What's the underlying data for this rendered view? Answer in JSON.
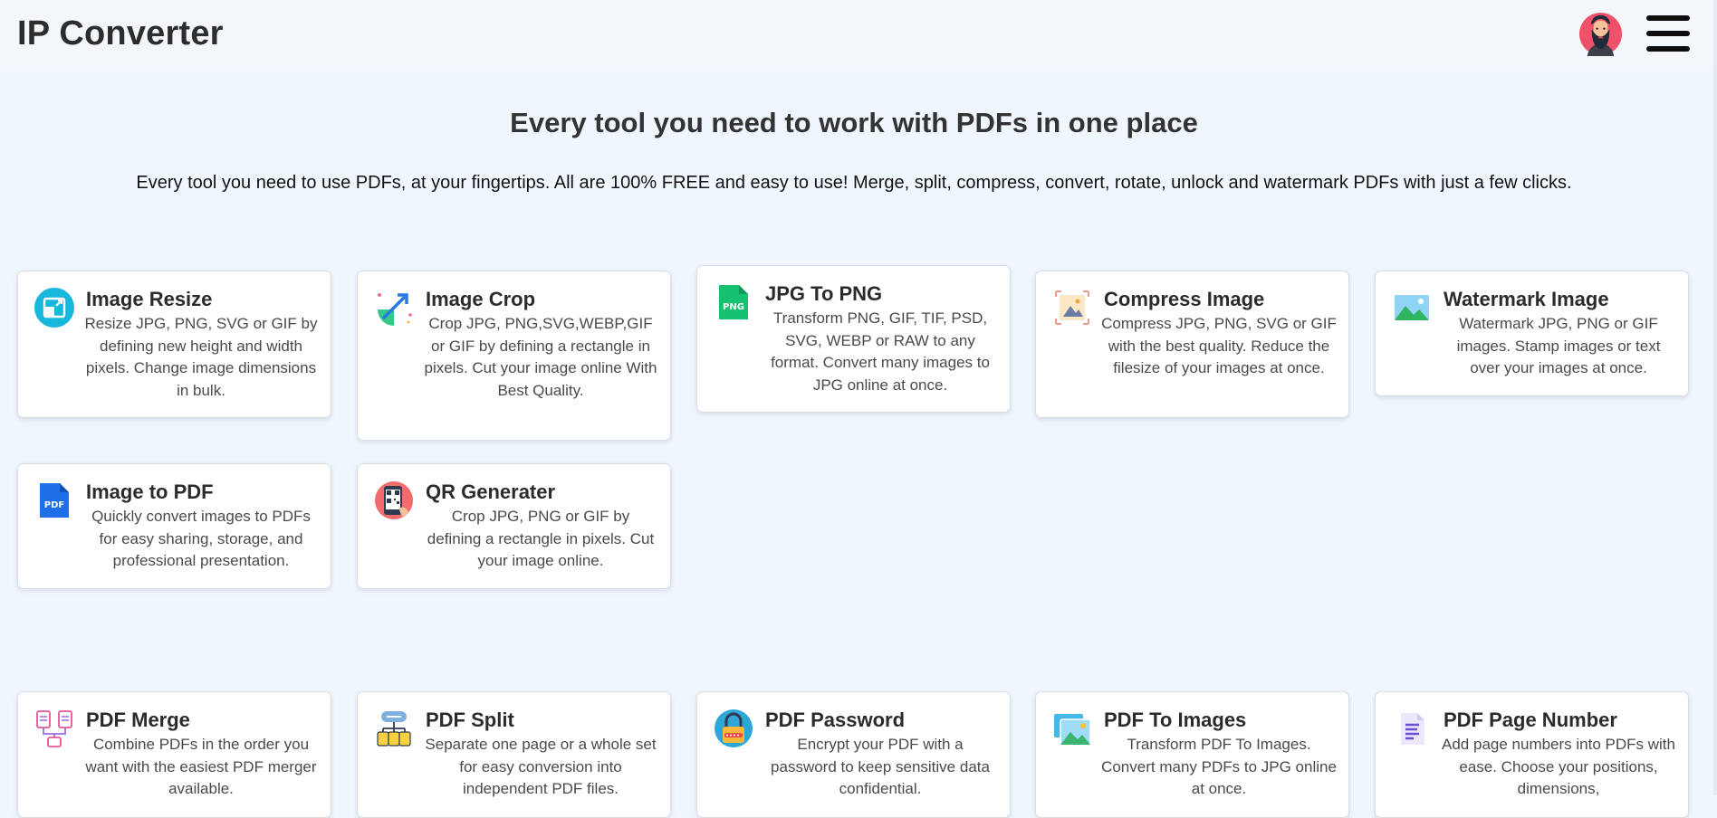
{
  "header": {
    "app_title": "IP Converter"
  },
  "hero": {
    "title": "Every tool you need to work with PDFs in one place",
    "subtitle": "Every tool you need to use PDFs, at your fingertips. All are 100% FREE and easy to use! Merge, split, compress, convert, rotate, unlock and watermark PDFs with just a few clicks."
  },
  "image_tools": [
    {
      "title": "Image Resize",
      "desc": "Resize JPG, PNG, SVG or GIF by defining new height and width pixels. Change image dimensions in bulk.",
      "icon": "image-resize-icon"
    },
    {
      "title": "Image Crop",
      "desc": "Crop JPG, PNG,SVG,WEBP,GIF or GIF by defining a rectangle in pixels. Cut your image online With Best Quality.",
      "icon": "crop-icon"
    },
    {
      "title": "JPG To PNG",
      "desc": "Transform PNG, GIF, TIF, PSD, SVG, WEBP or RAW to any format. Convert many images to JPG online at once.",
      "icon": "png-file-icon",
      "icon_text": "PNG"
    },
    {
      "title": "Compress Image",
      "desc": "Compress JPG, PNG, SVG or GIF with the best quality. Reduce the filesize of your images at once.",
      "icon": "compress-image-icon"
    },
    {
      "title": "Watermark Image",
      "desc": "Watermark JPG, PNG or GIF images. Stamp images or text over your images at once.",
      "icon": "landscape-image-icon"
    },
    {
      "title": "Image to PDF",
      "desc": "Quickly convert images to PDFs for easy sharing, storage, and professional presentation.",
      "icon": "pdf-file-icon",
      "icon_text": "PDF"
    },
    {
      "title": "QR Generater",
      "desc": "Crop JPG, PNG or GIF by defining a rectangle in pixels. Cut your image online.",
      "icon": "qr-phone-icon"
    }
  ],
  "pdf_tools": [
    {
      "title": "PDF Merge",
      "desc": "Combine PDFs in the order you want with the easiest PDF merger available.",
      "icon": "merge-icon"
    },
    {
      "title": "PDF Split",
      "desc": "Separate one page or a whole set for easy conversion into independent PDF files.",
      "icon": "split-icon"
    },
    {
      "title": "PDF Password",
      "desc": "Encrypt your PDF with a password to keep sensitive data confidential.",
      "icon": "lock-icon"
    },
    {
      "title": "PDF To Images",
      "desc": "Transform PDF To Images. Convert many PDFs to JPG online at once.",
      "icon": "pictures-icon"
    },
    {
      "title": "PDF Page Number",
      "desc": "Add page numbers into PDFs with ease. Choose your positions, dimensions,",
      "icon": "page-number-icon"
    }
  ]
}
